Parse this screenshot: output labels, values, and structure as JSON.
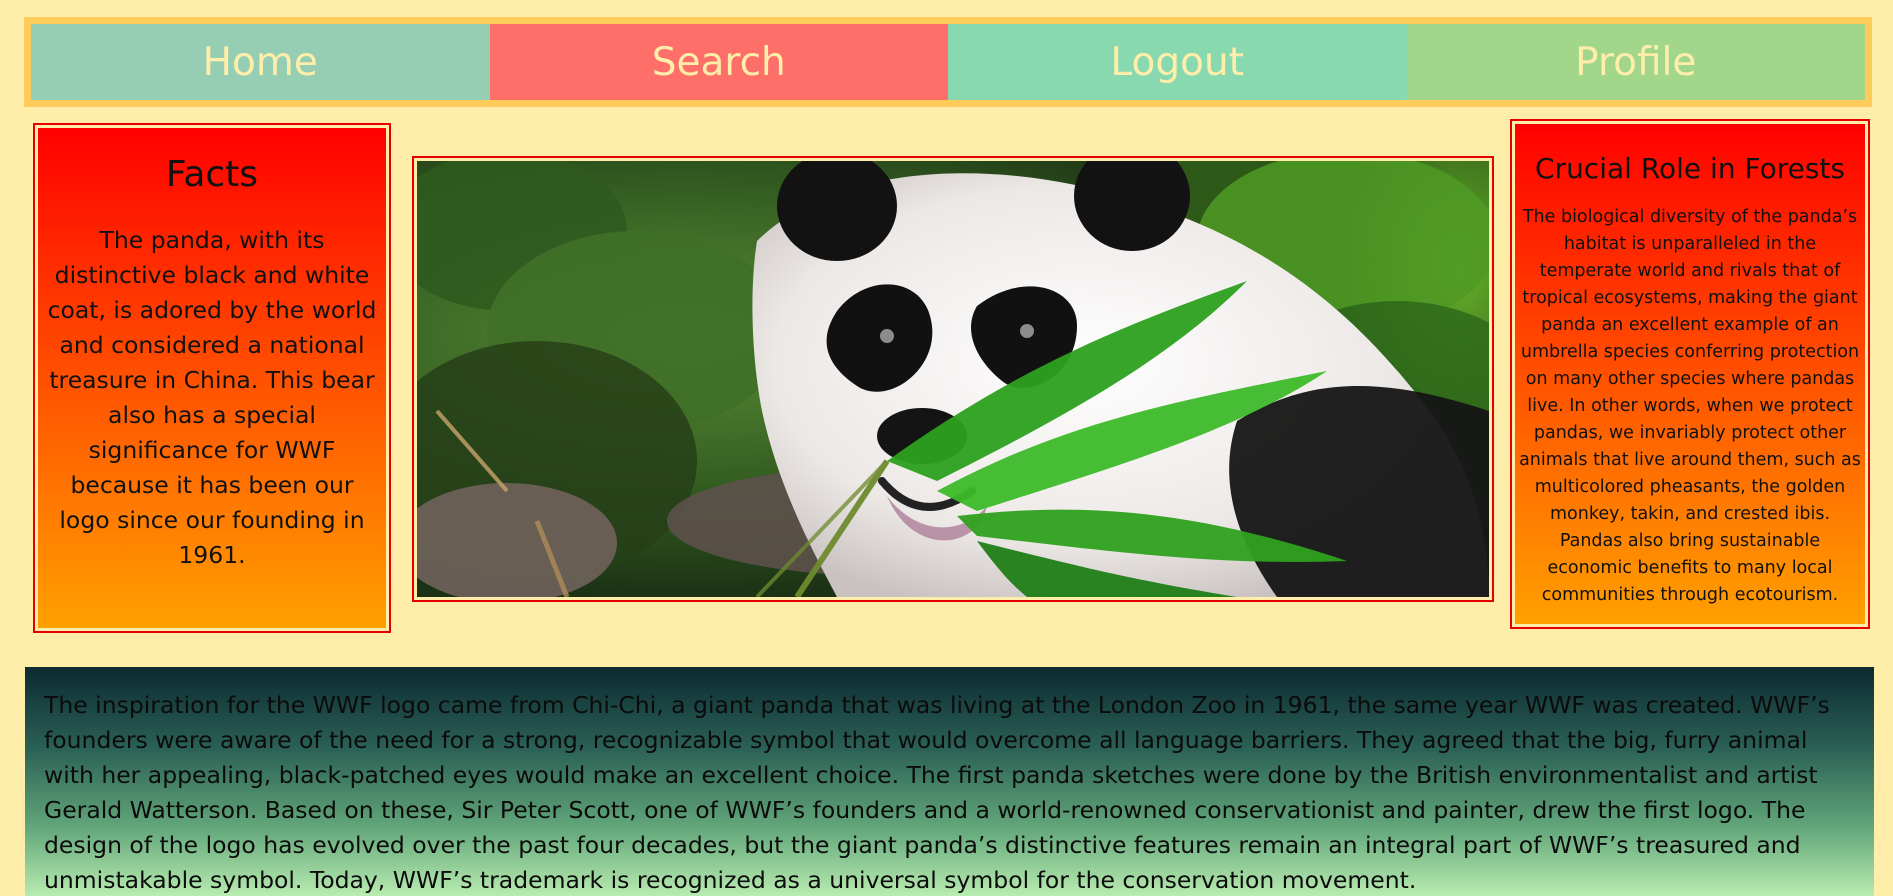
{
  "nav": {
    "items": [
      {
        "label": "Home",
        "color": "#96ceb4"
      },
      {
        "label": "Search",
        "color": "#ff6f69"
      },
      {
        "label": "Logout",
        "color": "#88d8b0"
      },
      {
        "label": "Profile",
        "color": "#a1d68b"
      }
    ]
  },
  "facts": {
    "title": "Facts",
    "text": "The panda, with its distinctive black and white coat, is adored by the world and considered a national treasure in China. This bear also has a special significance for WWF because it has been our logo since our founding in 1961."
  },
  "role": {
    "title": "Crucial Role in Forests",
    "text": "The biological diversity of the panda’s habitat is unparalleled in the temperate world and rivals that of tropical ecosystems, making the giant panda an excellent example of an umbrella species conferring protection on many other species where pandas live. In other words, when we protect pandas, we invariably protect other animals that live around them, such as multicolored pheasants, the golden monkey, takin, and crested ibis. Pandas also bring sustainable economic benefits to many local communities through ecotourism."
  },
  "story": {
    "text": "The inspiration for the WWF logo came from Chi-Chi, a giant panda that was living at the London Zoo in 1961, the same year WWF was created. WWF’s founders were aware of the need for a strong, recognizable symbol that would overcome all language barriers. They agreed that the big, furry animal with her appealing, black-patched eyes would make an excellent choice. The first panda sketches were done by the British environmentalist and artist Gerald Watterson. Based on these, Sir Peter Scott, one of WWF’s founders and a world-renowned conservationist and painter, drew the first logo. The design of the logo has evolved over the past four decades, but the giant panda’s distinctive features remain an integral part of WWF’s treasured and unmistakable symbol. Today, WWF’s trademark is recognized as a universal symbol for the conservation movement."
  },
  "colors": {
    "page_background": "#ffeeaa",
    "nav_border": "#ffcc5c",
    "card_border": "#e60000",
    "card_gradient_top": "#ff0000",
    "card_gradient_bottom": "#ffa000"
  },
  "image": {
    "icon": "panda-photo"
  }
}
